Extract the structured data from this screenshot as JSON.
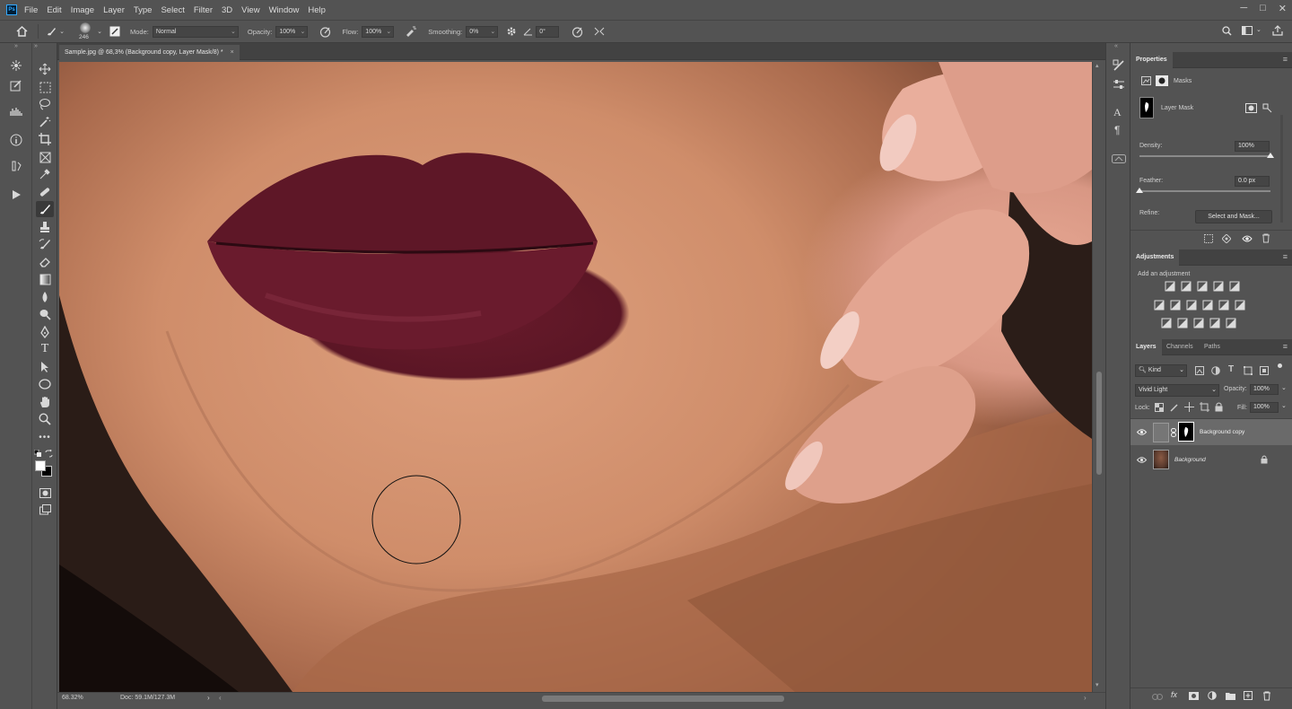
{
  "menu": [
    "File",
    "Edit",
    "Image",
    "Layer",
    "Type",
    "Select",
    "Filter",
    "3D",
    "View",
    "Window",
    "Help"
  ],
  "app_badge": "Ps",
  "window_controls": [
    "─",
    "□",
    "✕"
  ],
  "options": {
    "brush_size": "246",
    "mode_label": "Mode:",
    "mode_value": "Normal",
    "opacity_label": "Opacity:",
    "opacity_value": "100%",
    "flow_label": "Flow:",
    "flow_value": "100%",
    "smoothing_label": "Smoothing:",
    "smoothing_value": "0%",
    "angle_value": "0°"
  },
  "document": {
    "tab_title": "Sample.jpg @ 68,3% (Background copy, Layer Mask/8) *",
    "tab_close": "×",
    "zoom": "68.32%",
    "doc_info": "Doc: 59.1M/127.3M"
  },
  "properties": {
    "title": "Properties",
    "subtitle": "Masks",
    "mask_label": "Layer Mask",
    "density_label": "Density:",
    "density_value": "100%",
    "density_fraction": 1.0,
    "feather_label": "Feather:",
    "feather_value": "0.0 px",
    "feather_fraction": 0.0,
    "refine_label": "Refine:",
    "select_mask_button": "Select and Mask..."
  },
  "adjustments": {
    "title": "Adjustments",
    "subtitle": "Add an adjustment"
  },
  "layers_panel": {
    "tabs": [
      "Layers",
      "Channels",
      "Paths"
    ],
    "filter_kind": "Kind",
    "blend_mode": "Vivid Light",
    "opacity_label": "Opacity:",
    "opacity_value": "100%",
    "lock_label": "Lock:",
    "fill_label": "Fill:",
    "fill_value": "100%",
    "layers": [
      {
        "name": "Background copy",
        "selected": true
      },
      {
        "name": "Background",
        "selected": false
      }
    ]
  },
  "colors": {
    "ui_bg": "#535353",
    "panel_dark": "#424242",
    "lip": "#5b1625",
    "skin": "#cf8d6a"
  }
}
